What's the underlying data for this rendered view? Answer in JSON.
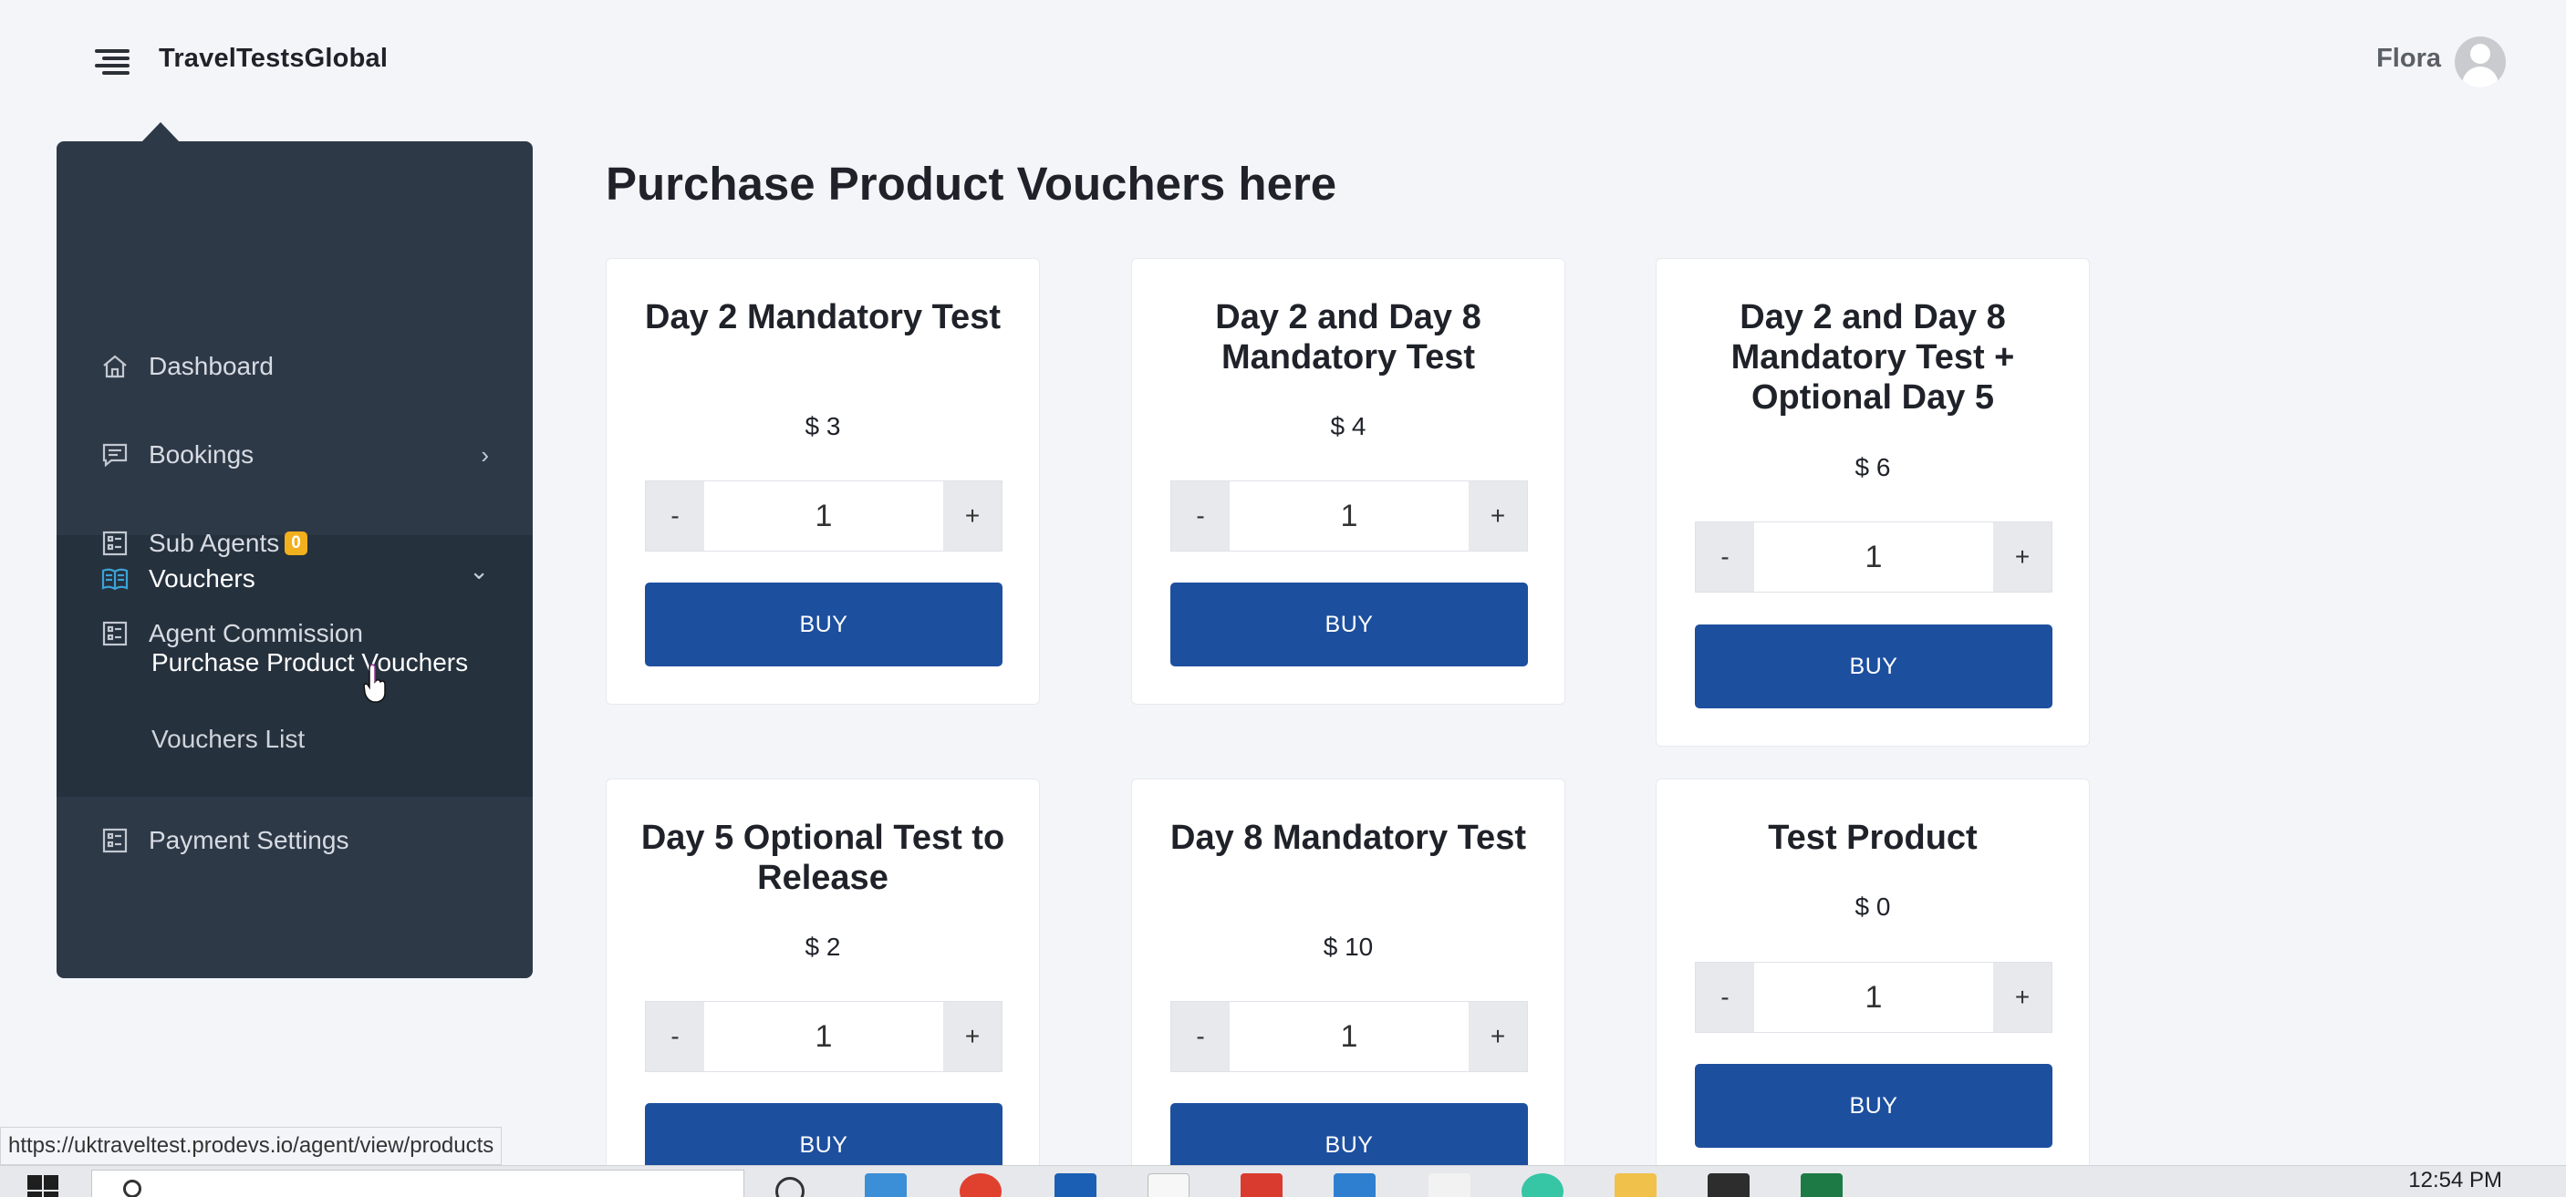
{
  "header": {
    "brand": "TravelTestsGlobal",
    "user_name": "Flora",
    "icons": {
      "menu": "hamburger-icon",
      "avatar": "user-avatar-icon"
    }
  },
  "sidebar": {
    "items": [
      {
        "label": "Dashboard",
        "icon": "home-icon"
      },
      {
        "label": "Bookings",
        "icon": "chat-icon",
        "chevron": "›"
      },
      {
        "label": "Sub Agents",
        "icon": "list-icon",
        "badge": "0"
      },
      {
        "label": "Agent Commission",
        "icon": "list-icon"
      },
      {
        "label": "Vouchers",
        "icon": "book-icon",
        "chevron": "⌄"
      },
      {
        "label": "Payment Settings",
        "icon": "list-icon"
      }
    ],
    "subitems": [
      {
        "label": "Purchase Product Vouchers"
      },
      {
        "label": "Vouchers List"
      }
    ]
  },
  "main": {
    "title": "Purchase Product Vouchers here",
    "products": [
      {
        "title": "Day 2 Mandatory Test",
        "price": "$ 3",
        "qty": "1",
        "buy": "BUY"
      },
      {
        "title": "Day 2 and Day 8 Mandatory Test",
        "price": "$ 4",
        "qty": "1",
        "buy": "BUY"
      },
      {
        "title": "Day 2 and Day 8 Mandatory Test + Optional Day 5",
        "price": "$ 6",
        "qty": "1",
        "buy": "BUY"
      },
      {
        "title": "Day 5 Optional Test to Release",
        "price": "$ 2",
        "qty": "1",
        "buy": "BUY"
      },
      {
        "title": "Day 8 Mandatory Test",
        "price": "$ 10",
        "qty": "1",
        "buy": "BUY"
      },
      {
        "title": "Test Product",
        "price": "$ 0",
        "qty": "1",
        "buy": "BUY"
      }
    ],
    "minus_label": "-",
    "plus_label": "+"
  },
  "status_bar": {
    "url": "https://uktraveltest.prodevs.io/agent/view/products"
  },
  "taskbar": {
    "clock": "12:54 PM"
  },
  "colors": {
    "sidebar_bg": "#2e3948",
    "sidebar_active_bg": "#26313e",
    "buy_button": "#1d4f9f",
    "badge": "#f2b01e",
    "page_bg": "#f3f5f9"
  }
}
